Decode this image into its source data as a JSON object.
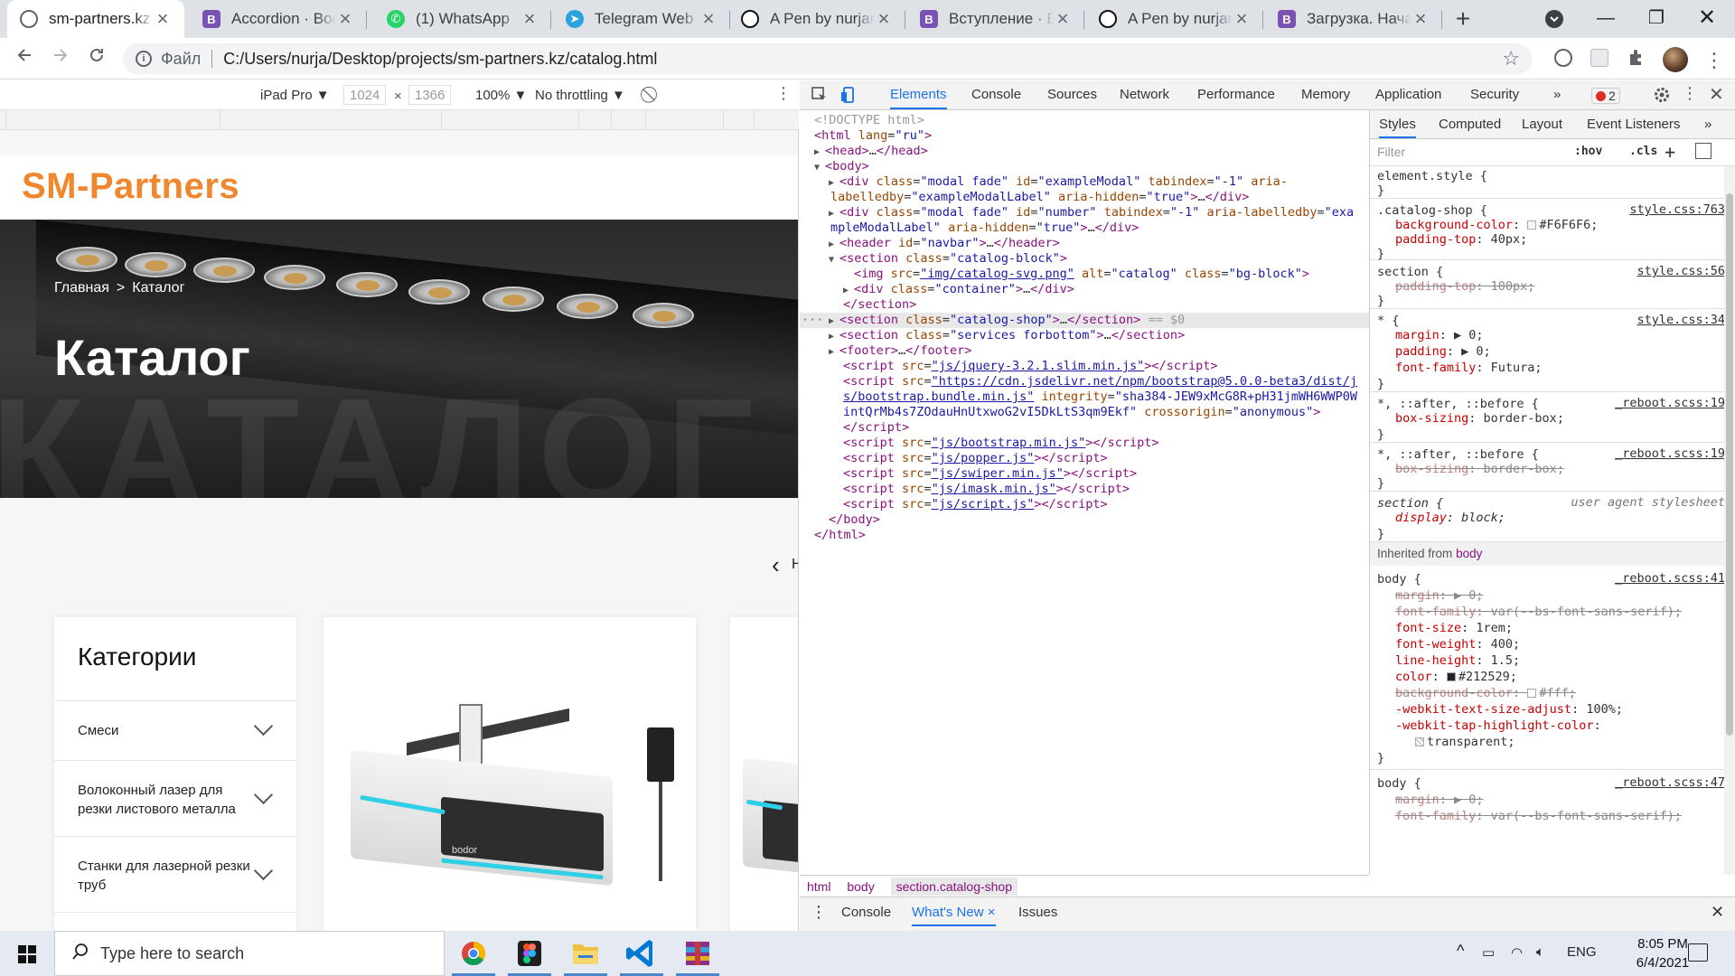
{
  "browser": {
    "tabs": [
      {
        "title": "sm-partners.kz",
        "icon": "globe-icon",
        "active": true
      },
      {
        "title": "Accordion · Boots",
        "icon": "bootstrap-icon"
      },
      {
        "title": "(1) WhatsApp",
        "icon": "whatsapp-icon"
      },
      {
        "title": "Telegram Web",
        "icon": "telegram-icon"
      },
      {
        "title": "A Pen by nurjand",
        "icon": "codepen-icon"
      },
      {
        "title": "Вступление · Boo",
        "icon": "bootstrap-icon"
      },
      {
        "title": "A Pen by nurjand",
        "icon": "codepen-icon"
      },
      {
        "title": "Загрузка. Начал",
        "icon": "bootstrap-icon"
      }
    ],
    "address": {
      "scheme_label": "Файл",
      "url": "C:/Users/nurja/Desktop/projects/sm-partners.kz/catalog.html"
    }
  },
  "device_toolbar": {
    "device": "iPad Pro ▼",
    "width": "1024",
    "times": "×",
    "height": "1366",
    "zoom": "100% ▼",
    "throttling": "No throttling ▼"
  },
  "site": {
    "logo": "SM-Partners",
    "breadcrumb": {
      "home": "Главная",
      "separator": ">",
      "current": "Каталог"
    },
    "title": "Каталог",
    "watermark": "КАТАЛОГ",
    "slider_prev": "‹",
    "slider_next": "Н",
    "categories": {
      "title": "Категории",
      "items": [
        "Смеси",
        "Волоконный лазер для резки листового металла",
        "Станки для лазерной резки труб"
      ]
    },
    "product_brand": "bodor"
  },
  "devtools": {
    "tabs": [
      "Elements",
      "Console",
      "Sources",
      "Network",
      "Performance",
      "Memory",
      "Application",
      "Security",
      "»"
    ],
    "active_tab": "Elements",
    "error_count": "2",
    "breadcrumbs": [
      "html",
      "body",
      "section.catalog-shop"
    ],
    "drawer_tabs": [
      "Console",
      "What's New",
      "Issues"
    ],
    "drawer_close": "×",
    "styles_tabs": [
      "Styles",
      "Computed",
      "Layout",
      "Event Listeners",
      "»"
    ],
    "filter_placeholder": "Filter",
    "filter_hov": ":hov",
    "filter_cls": ".cls",
    "inherited_label": "Inherited from",
    "inherited_from": "body"
  },
  "taskbar": {
    "search_placeholder": "Type here to search",
    "language": "ENG",
    "time": "8:05 PM",
    "date": "6/4/2021"
  },
  "colors": {
    "logo_orange": "#f0862d",
    "devtools_blue": "#1a73e8",
    "tag_purple": "#881280",
    "attr_name": "#994500",
    "attr_value": "#1a1aa6"
  }
}
